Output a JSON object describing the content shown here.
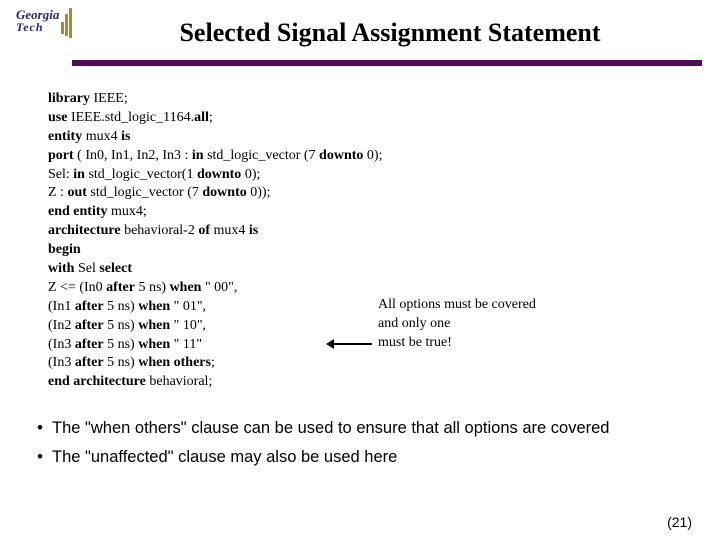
{
  "logo": {
    "line1": "Georgia",
    "line2": "Tech"
  },
  "title": "Selected Signal Assignment Statement",
  "code": {
    "l1a": "library",
    "l1b": " IEEE;",
    "l2a": "use",
    "l2b": " IEEE.std_logic_1164.",
    "l2c": "all",
    "l2d": ";",
    "l3a": "entity",
    "l3b": " mux4 ",
    "l3c": "is",
    "l4a": "port",
    "l4b": " ( In0, In1, In2, In3 : ",
    "l4c": "in",
    "l4d": " std_logic_vector (7 ",
    "l4e": "downto",
    "l4f": " 0);",
    "l5a": "Sel: ",
    "l5b": "in",
    "l5c": " std_logic_vector(1 ",
    "l5d": "downto",
    "l5e": " 0);",
    "l6a": "Z : ",
    "l6b": "out",
    "l6c": " std_logic_vector (7 ",
    "l6d": "downto",
    "l6e": " 0));",
    "l7a": "end entity",
    "l7b": " mux4;",
    "l8a": "architecture",
    "l8b": " behavioral-2 ",
    "l8c": "of",
    "l8d": " mux4 ",
    "l8e": "is",
    "l9": "begin",
    "l10a": "with",
    "l10b": " Sel ",
    "l10c": "select",
    "l11a": "Z <= (In0 ",
    "l11b": "after",
    "l11c": " 5 ns) ",
    "l11d": "when",
    "l11e": " \" 00\",",
    "l12a": "(In1 ",
    "l12b": "after",
    "l12c": " 5 ns) ",
    "l12d": "when",
    "l12e": " \" 01\",",
    "l13a": "(In2 ",
    "l13b": "after",
    "l13c": " 5 ns) ",
    "l13d": "when",
    "l13e": " \" 10\",",
    "l14a": "(In3 ",
    "l14b": "after",
    "l14c": " 5 ns) ",
    "l14d": "when",
    "l14e": " \" 11\"",
    "l15a": "(In3 ",
    "l15b": "after",
    "l15c": " 5 ns) ",
    "l15d": "when others",
    "l15e": ";",
    "l16a": "end architecture",
    "l16b": " behavioral;"
  },
  "annotation": {
    "line1": "All options must be covered",
    "line2": "and only one",
    "line3": "must be true!"
  },
  "bullets": [
    "The \"when others\" clause can be used to ensure that all options are covered",
    "The \"unaffected\" clause may also be used here"
  ],
  "slidenum": "(21)"
}
